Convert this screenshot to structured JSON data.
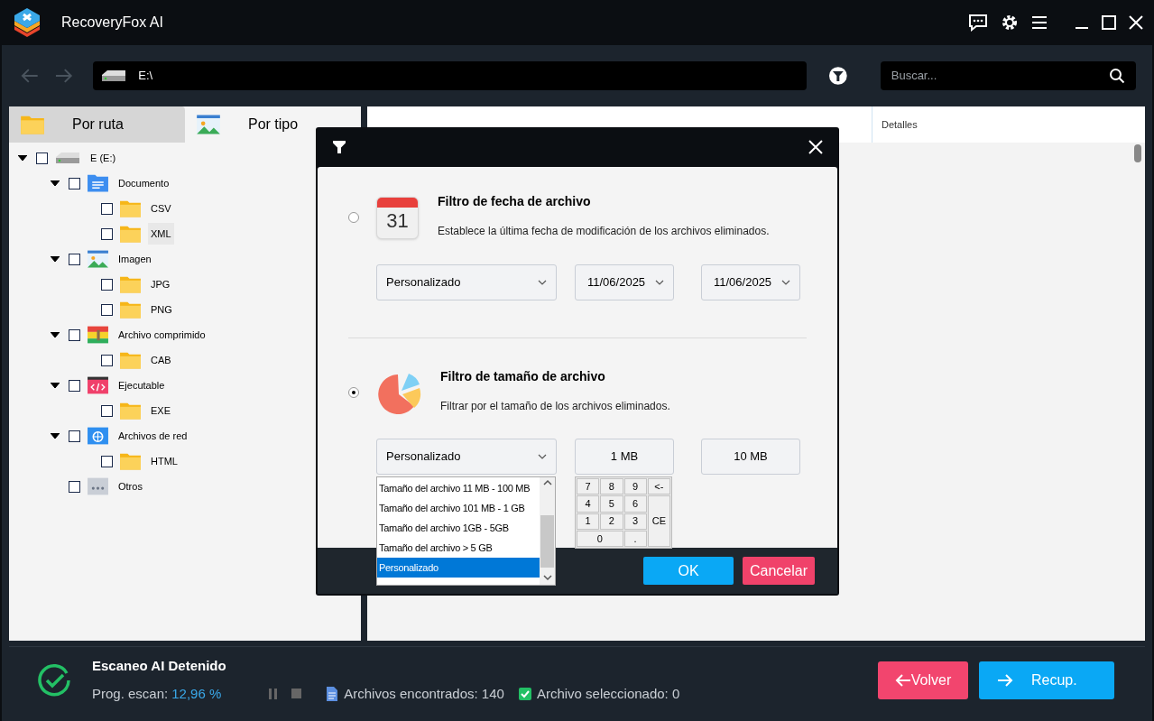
{
  "app": {
    "title": "RecoveryFox AI"
  },
  "address_bar": {
    "value": "E:\\"
  },
  "search": {
    "placeholder": "Buscar..."
  },
  "tabs": [
    {
      "label": "Por ruta",
      "kind": "folder",
      "selected": false
    },
    {
      "label": "Por tipo",
      "kind": "image",
      "selected": true
    }
  ],
  "tree": [
    {
      "label": "E (E:)",
      "kind": "drive",
      "checked": false,
      "expanded": true,
      "selected": false,
      "children": [
        {
          "label": "Documento",
          "kind": "doc",
          "checked": false,
          "expanded": true,
          "selected": false,
          "children": [
            {
              "label": "CSV",
              "kind": "folder",
              "checked": false,
              "selected": false
            },
            {
              "label": "XML",
              "kind": "folder",
              "checked": false,
              "selected": true
            }
          ]
        },
        {
          "label": "Imagen",
          "kind": "image",
          "checked": false,
          "expanded": true,
          "selected": false,
          "children": [
            {
              "label": "JPG",
              "kind": "folder",
              "checked": false,
              "selected": false
            },
            {
              "label": "PNG",
              "kind": "folder",
              "checked": false,
              "selected": false
            }
          ]
        },
        {
          "label": "Archivo comprimido",
          "kind": "zip",
          "checked": false,
          "expanded": true,
          "selected": false,
          "children": [
            {
              "label": "CAB",
              "kind": "folder",
              "checked": false,
              "selected": false
            }
          ]
        },
        {
          "label": "Ejecutable",
          "kind": "exe",
          "checked": false,
          "expanded": true,
          "selected": false,
          "children": [
            {
              "label": "EXE",
              "kind": "folder",
              "checked": false,
              "selected": false
            }
          ]
        },
        {
          "label": "Archivos de red",
          "kind": "web",
          "checked": false,
          "expanded": true,
          "selected": false,
          "children": [
            {
              "label": "HTML",
              "kind": "folder",
              "checked": false,
              "selected": false
            }
          ]
        },
        {
          "label": "Otros",
          "kind": "other",
          "checked": false,
          "selected": false
        }
      ]
    }
  ],
  "file_list": {
    "columns": [
      "Detalles"
    ]
  },
  "filter_dialog": {
    "sections": [
      {
        "title": "Filtro de fecha de archivo",
        "description": "Establece la última fecha de modificación de los archivos eliminados.",
        "kind": "calendar",
        "icon_text": "31",
        "selected": false,
        "controls": [
          {
            "kind": "dropdown",
            "value": "Personalizado"
          },
          {
            "kind": "dropdown",
            "value": "11/06/2025"
          },
          {
            "kind": "dropdown",
            "value": "11/06/2025"
          }
        ]
      },
      {
        "title": "Filtro de tamaño de archivo",
        "description": "Filtrar por el tamaño de los archivos eliminados.",
        "kind": "pie",
        "selected": true,
        "controls": [
          {
            "kind": "dropdown",
            "value": "Personalizado"
          },
          {
            "kind": "field",
            "value": "1 MB"
          },
          {
            "kind": "field",
            "value": "10 MB"
          }
        ]
      }
    ],
    "size_options": [
      {
        "label": "Tamaño del archivo 11 MB - 100 MB",
        "selected": false
      },
      {
        "label": "Tamaño del archivo 101 MB - 1 GB",
        "selected": false
      },
      {
        "label": "Tamaño del archivo 1GB - 5GB",
        "selected": false
      },
      {
        "label": "Tamaño del archivo > 5 GB",
        "selected": false
      },
      {
        "label": "Personalizado",
        "selected": true
      }
    ],
    "keypad": [
      {
        "label": "7",
        "kind": "key"
      },
      {
        "label": "8",
        "kind": "key"
      },
      {
        "label": "9",
        "kind": "key"
      },
      {
        "label": "<-",
        "kind": "key"
      },
      {
        "label": "4",
        "kind": "key"
      },
      {
        "label": "5",
        "kind": "key"
      },
      {
        "label": "6",
        "kind": "key"
      },
      {
        "label": "1",
        "kind": "key"
      },
      {
        "label": "2",
        "kind": "key"
      },
      {
        "label": "3",
        "kind": "key"
      },
      {
        "label": "CE",
        "kind": "tall"
      },
      {
        "label": "0",
        "kind": "wide"
      },
      {
        "label": ".",
        "kind": "key"
      }
    ],
    "buttons": [
      {
        "label": "OK",
        "kind": "primary"
      },
      {
        "label": "Cancelar",
        "kind": "danger"
      }
    ]
  },
  "status": {
    "title": "Escaneo AI Detenido",
    "progress_label": "Prog. escan:",
    "progress_value": "12,96 %",
    "found": "Archivos encontrados: 140",
    "selected_count": "Archivo seleccionado: 0"
  },
  "bottom_buttons": [
    {
      "label": "Volver",
      "kind": "back"
    },
    {
      "label": "Recup.",
      "kind": "recover"
    }
  ]
}
